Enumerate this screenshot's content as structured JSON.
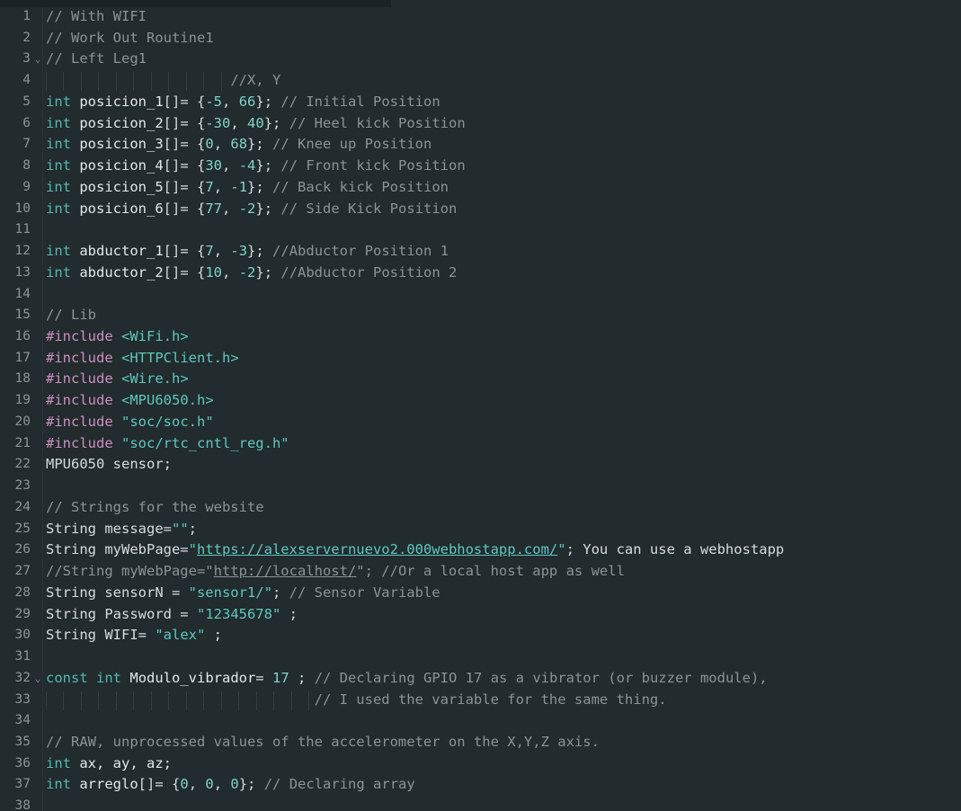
{
  "editor": {
    "language": "arduino-cpp",
    "theme": "dark-teal",
    "background_color": "#222b2d",
    "gutter_rule_color": "#2b3436",
    "line_number_color": "#8b9698",
    "first_visible_line": 1,
    "last_visible_line": 38,
    "total_visible_lines": 38,
    "fold_chevron_glyph": "⌄",
    "fold_lines": [
      3,
      32
    ],
    "colors": {
      "keyword": "#54b9b0",
      "type": "#54b9b0",
      "number": "#7fd4c8",
      "comment": "#8a9497",
      "preprocessor": "#cc8fc4",
      "include_path": "#5ec8c0",
      "string": "#5ec8c0",
      "plain": "#d6dcdd",
      "indent_guide": "#333e40"
    }
  },
  "lines": [
    {
      "n": 1,
      "fold": false,
      "guides": 0,
      "tokens": [
        {
          "c": "comment",
          "t": "// With WIFI"
        }
      ]
    },
    {
      "n": 2,
      "fold": false,
      "guides": 0,
      "tokens": [
        {
          "c": "comment",
          "t": "// Work Out Routine1"
        }
      ]
    },
    {
      "n": 3,
      "fold": true,
      "guides": 0,
      "tokens": [
        {
          "c": "comment",
          "t": "// Left Leg1"
        }
      ]
    },
    {
      "n": 4,
      "fold": false,
      "guides": 11,
      "tokens": [
        {
          "c": "plain",
          "t": "                      "
        },
        {
          "c": "comment",
          "t": "//X, Y"
        }
      ]
    },
    {
      "n": 5,
      "fold": false,
      "guides": 0,
      "tokens": [
        {
          "c": "type",
          "t": "int"
        },
        {
          "c": "plain",
          "t": " "
        },
        {
          "c": "ident",
          "t": "posicion_1"
        },
        {
          "c": "punc",
          "t": "[]= {"
        },
        {
          "c": "num",
          "t": "-5"
        },
        {
          "c": "punc",
          "t": ", "
        },
        {
          "c": "num",
          "t": "66"
        },
        {
          "c": "punc",
          "t": "}; "
        },
        {
          "c": "comment",
          "t": "// Initial Position"
        }
      ]
    },
    {
      "n": 6,
      "fold": false,
      "guides": 0,
      "tokens": [
        {
          "c": "type",
          "t": "int"
        },
        {
          "c": "plain",
          "t": " "
        },
        {
          "c": "ident",
          "t": "posicion_2"
        },
        {
          "c": "punc",
          "t": "[]= {"
        },
        {
          "c": "num",
          "t": "-30"
        },
        {
          "c": "punc",
          "t": ", "
        },
        {
          "c": "num",
          "t": "40"
        },
        {
          "c": "punc",
          "t": "}; "
        },
        {
          "c": "comment",
          "t": "// Heel kick Position"
        }
      ]
    },
    {
      "n": 7,
      "fold": false,
      "guides": 0,
      "tokens": [
        {
          "c": "type",
          "t": "int"
        },
        {
          "c": "plain",
          "t": " "
        },
        {
          "c": "ident",
          "t": "posicion_3"
        },
        {
          "c": "punc",
          "t": "[]= {"
        },
        {
          "c": "num",
          "t": "0"
        },
        {
          "c": "punc",
          "t": ", "
        },
        {
          "c": "num",
          "t": "68"
        },
        {
          "c": "punc",
          "t": "}; "
        },
        {
          "c": "comment",
          "t": "// Knee up Position"
        }
      ]
    },
    {
      "n": 8,
      "fold": false,
      "guides": 0,
      "tokens": [
        {
          "c": "type",
          "t": "int"
        },
        {
          "c": "plain",
          "t": " "
        },
        {
          "c": "ident",
          "t": "posicion_4"
        },
        {
          "c": "punc",
          "t": "[]= {"
        },
        {
          "c": "num",
          "t": "30"
        },
        {
          "c": "punc",
          "t": ", "
        },
        {
          "c": "num",
          "t": "-4"
        },
        {
          "c": "punc",
          "t": "}; "
        },
        {
          "c": "comment",
          "t": "// Front kick Position"
        }
      ]
    },
    {
      "n": 9,
      "fold": false,
      "guides": 0,
      "tokens": [
        {
          "c": "type",
          "t": "int"
        },
        {
          "c": "plain",
          "t": " "
        },
        {
          "c": "ident",
          "t": "posicion_5"
        },
        {
          "c": "punc",
          "t": "[]= {"
        },
        {
          "c": "num",
          "t": "7"
        },
        {
          "c": "punc",
          "t": ", "
        },
        {
          "c": "num",
          "t": "-1"
        },
        {
          "c": "punc",
          "t": "}; "
        },
        {
          "c": "comment",
          "t": "// Back kick Position"
        }
      ]
    },
    {
      "n": 10,
      "fold": false,
      "guides": 0,
      "tokens": [
        {
          "c": "type",
          "t": "int"
        },
        {
          "c": "plain",
          "t": " "
        },
        {
          "c": "ident",
          "t": "posicion_6"
        },
        {
          "c": "punc",
          "t": "[]= {"
        },
        {
          "c": "num",
          "t": "77"
        },
        {
          "c": "punc",
          "t": ", "
        },
        {
          "c": "num",
          "t": "-2"
        },
        {
          "c": "punc",
          "t": "}; "
        },
        {
          "c": "comment",
          "t": "// Side Kick Position"
        }
      ]
    },
    {
      "n": 11,
      "fold": false,
      "guides": 0,
      "tokens": []
    },
    {
      "n": 12,
      "fold": false,
      "guides": 0,
      "tokens": [
        {
          "c": "type",
          "t": "int"
        },
        {
          "c": "plain",
          "t": " "
        },
        {
          "c": "ident",
          "t": "abductor_1"
        },
        {
          "c": "punc",
          "t": "[]= {"
        },
        {
          "c": "num",
          "t": "7"
        },
        {
          "c": "punc",
          "t": ", "
        },
        {
          "c": "num",
          "t": "-3"
        },
        {
          "c": "punc",
          "t": "}; "
        },
        {
          "c": "comment",
          "t": "//Abductor Position 1"
        }
      ]
    },
    {
      "n": 13,
      "fold": false,
      "guides": 0,
      "tokens": [
        {
          "c": "type",
          "t": "int"
        },
        {
          "c": "plain",
          "t": " "
        },
        {
          "c": "ident",
          "t": "abductor_2"
        },
        {
          "c": "punc",
          "t": "[]= {"
        },
        {
          "c": "num",
          "t": "10"
        },
        {
          "c": "punc",
          "t": ", "
        },
        {
          "c": "num",
          "t": "-2"
        },
        {
          "c": "punc",
          "t": "}; "
        },
        {
          "c": "comment",
          "t": "//Abductor Position 2"
        }
      ]
    },
    {
      "n": 14,
      "fold": false,
      "guides": 0,
      "tokens": []
    },
    {
      "n": 15,
      "fold": false,
      "guides": 0,
      "tokens": [
        {
          "c": "comment",
          "t": "// Lib"
        }
      ]
    },
    {
      "n": 16,
      "fold": false,
      "guides": 0,
      "tokens": [
        {
          "c": "pre",
          "t": "#include"
        },
        {
          "c": "plain",
          "t": " "
        },
        {
          "c": "inc",
          "t": "<WiFi.h>"
        }
      ]
    },
    {
      "n": 17,
      "fold": false,
      "guides": 0,
      "tokens": [
        {
          "c": "pre",
          "t": "#include"
        },
        {
          "c": "plain",
          "t": " "
        },
        {
          "c": "inc",
          "t": "<HTTPClient.h>"
        }
      ]
    },
    {
      "n": 18,
      "fold": false,
      "guides": 0,
      "tokens": [
        {
          "c": "pre",
          "t": "#include"
        },
        {
          "c": "plain",
          "t": " "
        },
        {
          "c": "inc",
          "t": "<Wire.h>"
        }
      ]
    },
    {
      "n": 19,
      "fold": false,
      "guides": 0,
      "tokens": [
        {
          "c": "pre",
          "t": "#include"
        },
        {
          "c": "plain",
          "t": " "
        },
        {
          "c": "inc",
          "t": "<MPU6050.h>"
        }
      ]
    },
    {
      "n": 20,
      "fold": false,
      "guides": 0,
      "tokens": [
        {
          "c": "pre",
          "t": "#include"
        },
        {
          "c": "plain",
          "t": " "
        },
        {
          "c": "inc",
          "t": "\"soc/soc.h\""
        }
      ]
    },
    {
      "n": 21,
      "fold": false,
      "guides": 0,
      "tokens": [
        {
          "c": "pre",
          "t": "#include"
        },
        {
          "c": "plain",
          "t": " "
        },
        {
          "c": "inc",
          "t": "\"soc/rtc_cntl_reg.h\""
        }
      ]
    },
    {
      "n": 22,
      "fold": false,
      "guides": 0,
      "tokens": [
        {
          "c": "plain",
          "t": "MPU6050 sensor;"
        }
      ]
    },
    {
      "n": 23,
      "fold": false,
      "guides": 0,
      "tokens": []
    },
    {
      "n": 24,
      "fold": false,
      "guides": 0,
      "tokens": [
        {
          "c": "comment",
          "t": "// Strings for the website"
        }
      ]
    },
    {
      "n": 25,
      "fold": false,
      "guides": 0,
      "tokens": [
        {
          "c": "plain",
          "t": "String message="
        },
        {
          "c": "str",
          "t": "\"\""
        },
        {
          "c": "plain",
          "t": ";"
        }
      ]
    },
    {
      "n": 26,
      "fold": false,
      "guides": 0,
      "tokens": [
        {
          "c": "plain",
          "t": "String myWebPage="
        },
        {
          "c": "str",
          "t": "\""
        },
        {
          "c": "link",
          "t": "https://alexservernuevo2.000webhostapp.com/"
        },
        {
          "c": "str",
          "t": "\""
        },
        {
          "c": "plain",
          "t": "; You can use a webhostapp"
        }
      ]
    },
    {
      "n": 27,
      "fold": false,
      "guides": 0,
      "tokens": [
        {
          "c": "comment",
          "t": "//String myWebPage=\""
        },
        {
          "c": "link-dim",
          "t": "http://localhost/"
        },
        {
          "c": "comment",
          "t": "\"; //Or a local host app as well"
        }
      ]
    },
    {
      "n": 28,
      "fold": false,
      "guides": 0,
      "tokens": [
        {
          "c": "plain",
          "t": "String sensorN = "
        },
        {
          "c": "str",
          "t": "\"sensor1/\""
        },
        {
          "c": "plain",
          "t": "; "
        },
        {
          "c": "comment",
          "t": "// Sensor Variable"
        }
      ]
    },
    {
      "n": 29,
      "fold": false,
      "guides": 0,
      "tokens": [
        {
          "c": "plain",
          "t": "String Password = "
        },
        {
          "c": "str",
          "t": "\"12345678\""
        },
        {
          "c": "plain",
          "t": " ;"
        }
      ]
    },
    {
      "n": 30,
      "fold": false,
      "guides": 0,
      "tokens": [
        {
          "c": "plain",
          "t": "String WIFI= "
        },
        {
          "c": "str",
          "t": "\"alex\""
        },
        {
          "c": "plain",
          "t": " ;"
        }
      ]
    },
    {
      "n": 31,
      "fold": false,
      "guides": 0,
      "tokens": []
    },
    {
      "n": 32,
      "fold": true,
      "guides": 0,
      "tokens": [
        {
          "c": "kw",
          "t": "const"
        },
        {
          "c": "plain",
          "t": " "
        },
        {
          "c": "type",
          "t": "int"
        },
        {
          "c": "plain",
          "t": " "
        },
        {
          "c": "ident",
          "t": "Modulo_vibrador"
        },
        {
          "c": "punc",
          "t": "= "
        },
        {
          "c": "num",
          "t": "17"
        },
        {
          "c": "punc",
          "t": " ; "
        },
        {
          "c": "comment",
          "t": "// Declaring GPIO 17 as a vibrator (or buzzer module),"
        }
      ]
    },
    {
      "n": 33,
      "fold": false,
      "guides": 16,
      "tokens": [
        {
          "c": "plain",
          "t": "                                "
        },
        {
          "c": "comment",
          "t": "// I used the variable for the same thing."
        }
      ]
    },
    {
      "n": 34,
      "fold": false,
      "guides": 0,
      "tokens": []
    },
    {
      "n": 35,
      "fold": false,
      "guides": 0,
      "tokens": [
        {
          "c": "comment",
          "t": "// RAW, unprocessed values of the accelerometer on the X,Y,Z axis."
        }
      ]
    },
    {
      "n": 36,
      "fold": false,
      "guides": 0,
      "tokens": [
        {
          "c": "type",
          "t": "int"
        },
        {
          "c": "plain",
          "t": " "
        },
        {
          "c": "ident",
          "t": "ax, ay, az;"
        }
      ]
    },
    {
      "n": 37,
      "fold": false,
      "guides": 0,
      "tokens": [
        {
          "c": "type",
          "t": "int"
        },
        {
          "c": "plain",
          "t": " "
        },
        {
          "c": "ident",
          "t": "arreglo"
        },
        {
          "c": "punc",
          "t": "[]= {"
        },
        {
          "c": "num",
          "t": "0"
        },
        {
          "c": "punc",
          "t": ", "
        },
        {
          "c": "num",
          "t": "0"
        },
        {
          "c": "punc",
          "t": ", "
        },
        {
          "c": "num",
          "t": "0"
        },
        {
          "c": "punc",
          "t": "}; "
        },
        {
          "c": "comment",
          "t": "// Declaring array"
        }
      ]
    },
    {
      "n": 38,
      "fold": false,
      "guides": 0,
      "tokens": []
    }
  ]
}
